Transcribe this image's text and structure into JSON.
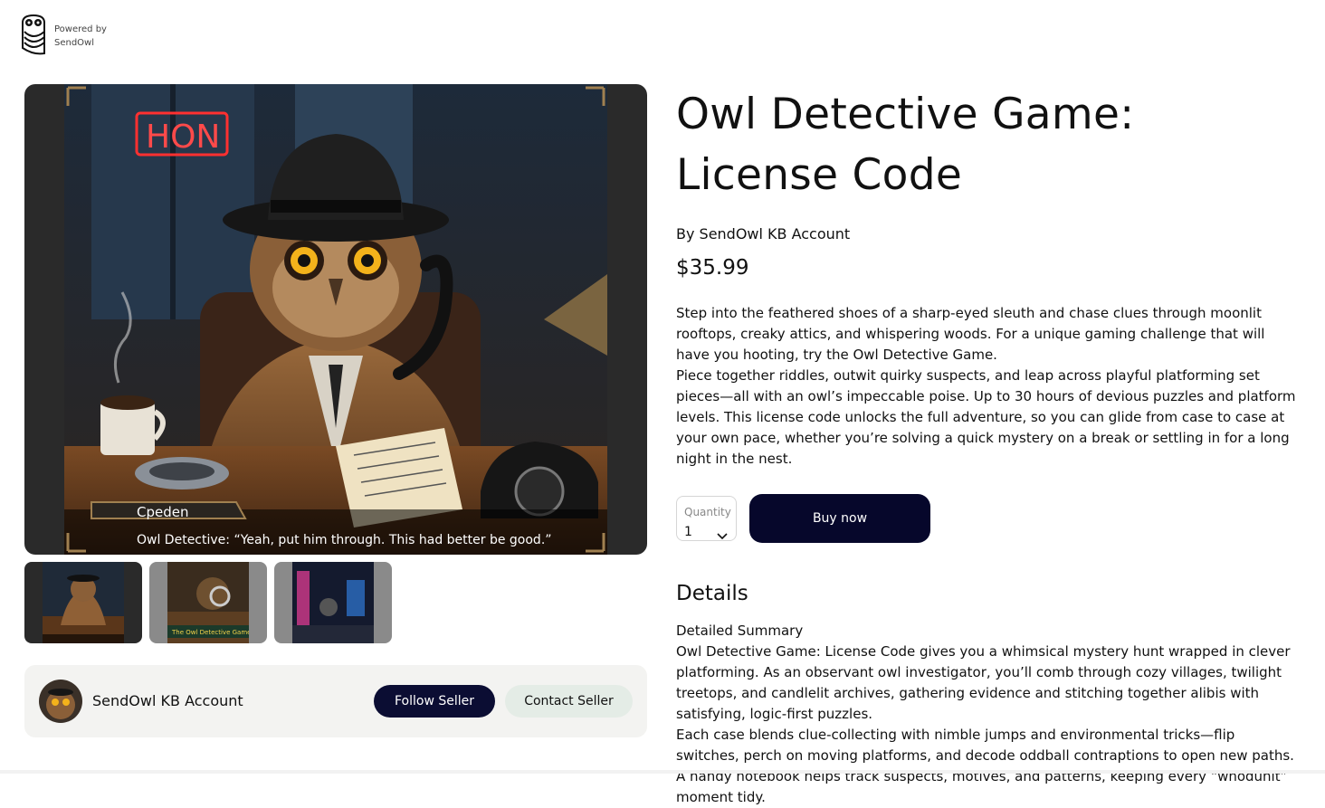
{
  "brand": {
    "powered_by": "Powered by",
    "name": "SendOwl",
    "icon": "owl-logo-icon"
  },
  "gallery": {
    "hero_caption_name": "Cpeden",
    "hero_caption_line": "Owl Detective: “Yeah, put him through. This had better be good.”",
    "hero_sign": "HON",
    "thumbnails": [
      {
        "label": ""
      },
      {
        "label": "The Owl Detective Game"
      },
      {
        "label": ""
      }
    ]
  },
  "seller": {
    "name": "SendOwl KB Account",
    "follow_label": "Follow Seller",
    "contact_label": "Contact Seller"
  },
  "product": {
    "title": "Owl Detective Game: License Code",
    "byline": "By SendOwl KB Account",
    "price": "$35.99",
    "description": [
      "Step into the feathered shoes of a sharp-eyed sleuth and chase clues through moonlit rooftops, creaky attics, and whispering woods. For a unique gaming challenge that will have you hooting, try the Owl Detective Game.",
      "Piece together riddles, outwit quirky suspects, and leap across playful platforming set pieces—all with an owl’s impeccable poise. Up to 30 hours of devious puzzles and platform levels. This license code unlocks the full adventure, so you can glide from case to case at your own pace, whether you’re solving a quick mystery on a break or settling in for a long night in the nest."
    ]
  },
  "purchase": {
    "quantity_label": "Quantity",
    "quantity_value": "1",
    "buy_label": "Buy now"
  },
  "details": {
    "heading": "Details",
    "summary_label": "Detailed Summary",
    "paragraphs": [
      "Owl Detective Game: License Code gives you a whimsical mystery hunt wrapped in clever platforming. As an observant owl investigator, you’ll comb through cozy villages, twilight treetops, and candlelit archives, gathering evidence and stitching together alibis with satisfying, logic-first puzzles.",
      "Each case blends clue-collecting with nimble jumps and environmental tricks—flip switches, perch on moving platforms, and decode oddball contraptions to open new paths. A handy notebook helps track suspects, motives, and patterns, keeping every “whodunit” moment tidy."
    ]
  },
  "colors": {
    "primary_button": "#0b0d33",
    "buy_button": "#06072b",
    "secondary_button": "#e4ece6",
    "card_bg": "#f3f3f1"
  }
}
